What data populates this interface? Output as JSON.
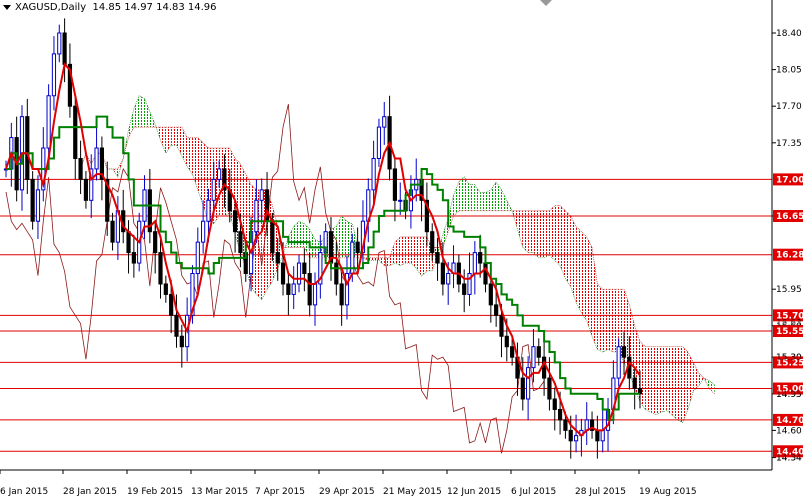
{
  "window": {
    "symbol": "XAGUSD,Daily",
    "ohlc": "14.85 14.97 14.83 14.96"
  },
  "chart_data": {
    "type": "candlestick",
    "title": "XAGUSD,Daily",
    "ylim": [
      14.3,
      18.6
    ],
    "y_ticks": [
      "18.40",
      "18.05",
      "17.70",
      "17.35",
      "16.65",
      "15.95",
      "15.60",
      "15.30",
      "14.95",
      "14.60",
      "14.34"
    ],
    "x_tick_labels": [
      "6 Jan 2015",
      "28 Jan 2015",
      "19 Feb 2015",
      "13 Mar 2015",
      "7 Apr 2015",
      "29 Apr 2015",
      "21 May 2015",
      "12 Jun 2015",
      "6 Jul 2015",
      "28 Jul 2015",
      "19 Aug 2015"
    ],
    "levels": [
      {
        "value": 17.0,
        "label": "17.00"
      },
      {
        "value": 16.65,
        "label": "16.65"
      },
      {
        "value": 16.28,
        "label": "16.28"
      },
      {
        "value": 15.7,
        "label": "15.70"
      },
      {
        "value": 15.55,
        "label": "15.55"
      },
      {
        "value": 15.25,
        "label": "15.25"
      },
      {
        "value": 15.0,
        "label": "15.00"
      },
      {
        "value": 14.7,
        "label": "14.70"
      },
      {
        "value": 14.4,
        "label": "14.40"
      }
    ],
    "hidden_tick_labels": [
      "15.63",
      "15.30",
      "14.95",
      "14.34"
    ],
    "current_price": 14.96,
    "colors": {
      "level_line": "#e00000",
      "level_box": "#e00000",
      "tenkan": "#e00000",
      "kijun": "#008000",
      "chikou": "#8b1a1a",
      "kumo_bear": "#e00000",
      "kumo_bull": "#00a000",
      "candle_bull": "#0000cc",
      "candle_bear": "#000000"
    },
    "price_path": [
      17.1,
      17.4,
      16.9,
      17.6,
      17.0,
      16.6,
      16.9,
      17.3,
      17.8,
      18.2,
      18.4,
      18.1,
      17.7,
      17.2,
      17.0,
      16.8,
      17.1,
      17.3,
      17.0,
      16.6,
      16.4,
      16.7,
      16.5,
      16.3,
      16.2,
      16.6,
      16.9,
      16.5,
      16.3,
      16.0,
      15.9,
      15.7,
      15.5,
      15.4,
      15.7,
      16.1,
      16.4,
      16.6,
      16.8,
      17.0,
      17.1,
      16.9,
      16.7,
      16.5,
      16.3,
      16.1,
      16.5,
      16.8,
      16.9,
      16.6,
      16.3,
      16.2,
      16.0,
      15.9,
      16.0,
      16.2,
      16.1,
      15.8,
      16.0,
      16.3,
      16.5,
      16.2,
      16.0,
      15.8,
      16.1,
      16.4,
      16.3,
      16.6,
      16.9,
      17.2,
      17.5,
      17.6,
      17.1,
      16.8,
      16.8,
      16.7,
      16.9,
      17.0,
      16.8,
      16.5,
      16.3,
      16.2,
      16.0,
      16.1,
      16.2,
      16.0,
      15.9,
      16.1,
      16.3,
      16.2,
      16.0,
      15.8,
      15.7,
      15.5,
      15.4,
      15.3,
      15.1,
      14.9,
      15.2,
      15.4,
      15.3,
      15.1,
      14.9,
      14.8,
      14.7,
      14.6,
      14.5,
      14.55,
      14.6,
      14.7,
      14.6,
      14.5,
      14.6,
      14.8,
      15.1,
      15.4,
      15.3,
      15.1,
      15.0,
      14.95
    ]
  }
}
